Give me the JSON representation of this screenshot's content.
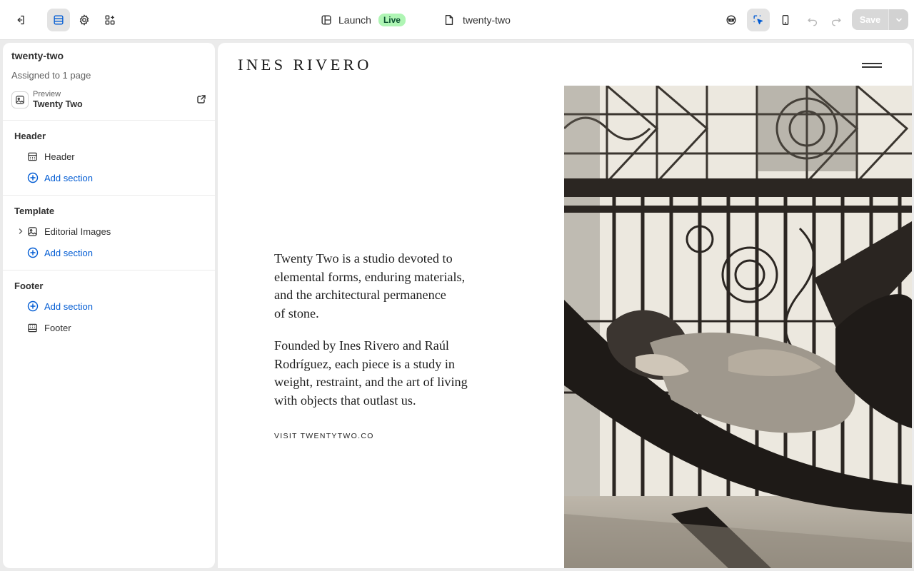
{
  "topbar": {
    "launch_label": "Launch",
    "live_badge": "Live",
    "current_page": "twenty-two",
    "save_label": "Save"
  },
  "sidebar": {
    "theme_name": "twenty-two",
    "assigned": "Assigned to 1 page",
    "preview_label": "Preview",
    "preview_name": "Twenty Two",
    "groups": [
      {
        "title": "Header",
        "items": [
          "Header"
        ],
        "add_label": "Add section"
      },
      {
        "title": "Template",
        "items": [
          "Editorial Images"
        ],
        "add_label": "Add section"
      },
      {
        "title": "Footer",
        "items": [
          "Footer"
        ],
        "add_label": "Add section"
      }
    ]
  },
  "preview": {
    "logo": "INES RIVERO",
    "paragraph1": "Twenty Two is a studio devoted to\nelemental forms, enduring materials,\nand the architectural permanence\nof stone.",
    "paragraph2": "Founded by Ines Rivero and Raúl\nRodríguez, each piece is a study in\nweight, restraint, and the art of living\nwith objects that outlast us.",
    "link": "VISIT TWENTYTWO.CO"
  }
}
